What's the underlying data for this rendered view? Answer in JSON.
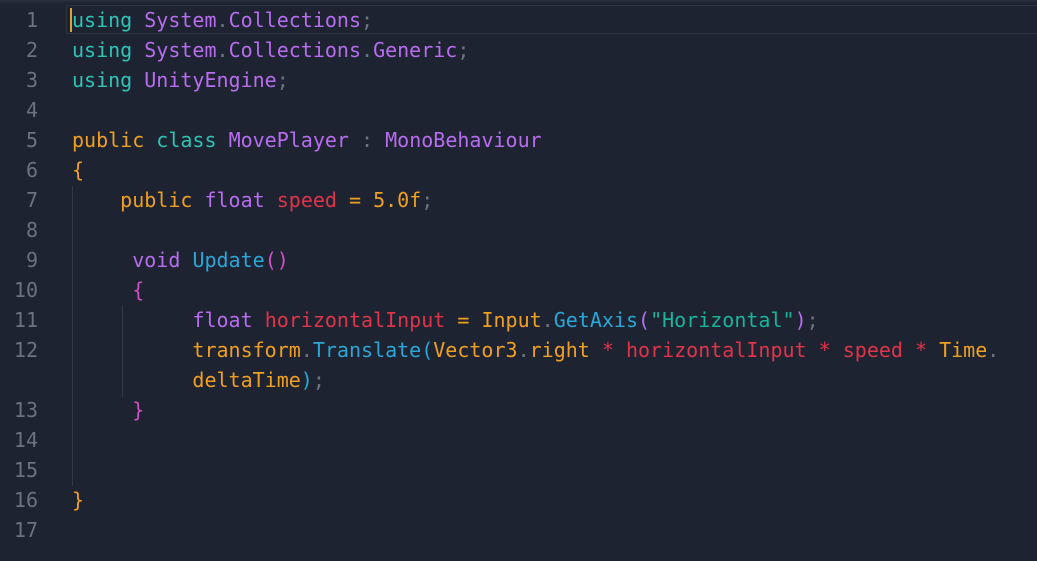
{
  "editor": {
    "line_numbers": [
      "1",
      "2",
      "3",
      "4",
      "5",
      "6",
      "7",
      "8",
      "9",
      "10",
      "11",
      "12",
      "13",
      "14",
      "15",
      "16",
      "17"
    ],
    "lines": [
      {
        "n": "1",
        "tokens": [
          [
            "using",
            "t-kw-teal"
          ],
          [
            " ",
            ""
          ],
          [
            "System",
            "t-class"
          ],
          [
            ".",
            "t-punct"
          ],
          [
            "Collections",
            "t-class"
          ],
          [
            ";",
            "t-punct"
          ]
        ]
      },
      {
        "n": "2",
        "tokens": [
          [
            "using",
            "t-kw-teal"
          ],
          [
            " ",
            ""
          ],
          [
            "System",
            "t-class"
          ],
          [
            ".",
            "t-punct"
          ],
          [
            "Collections",
            "t-class"
          ],
          [
            ".",
            "t-punct"
          ],
          [
            "Generic",
            "t-class"
          ],
          [
            ";",
            "t-punct"
          ]
        ]
      },
      {
        "n": "3",
        "tokens": [
          [
            "using",
            "t-kw-teal"
          ],
          [
            " ",
            ""
          ],
          [
            "UnityEngine",
            "t-class"
          ],
          [
            ";",
            "t-punct"
          ]
        ]
      },
      {
        "n": "4",
        "tokens": []
      },
      {
        "n": "5",
        "tokens": [
          [
            "public",
            "t-kw-orange"
          ],
          [
            " ",
            ""
          ],
          [
            "class",
            "t-kw-teal"
          ],
          [
            " ",
            ""
          ],
          [
            "MovePlayer",
            "t-class"
          ],
          [
            " ",
            ""
          ],
          [
            ":",
            "t-punct"
          ],
          [
            " ",
            ""
          ],
          [
            "MonoBehaviour",
            "t-class"
          ]
        ]
      },
      {
        "n": "6",
        "tokens": [
          [
            "{",
            "t-brace"
          ]
        ]
      },
      {
        "n": "7",
        "tokens": [
          [
            "    ",
            ""
          ],
          [
            "public",
            "t-kw-orange"
          ],
          [
            " ",
            ""
          ],
          [
            "float",
            "t-kw-purple"
          ],
          [
            " ",
            ""
          ],
          [
            "speed",
            "t-var"
          ],
          [
            " ",
            ""
          ],
          [
            "=",
            "t-op"
          ],
          [
            " ",
            ""
          ],
          [
            "5.0f",
            "t-num"
          ],
          [
            ";",
            "t-punct"
          ]
        ]
      },
      {
        "n": "8",
        "tokens": []
      },
      {
        "n": "9",
        "tokens": [
          [
            "     ",
            ""
          ],
          [
            "void",
            "t-kw-purple"
          ],
          [
            " ",
            ""
          ],
          [
            "Update",
            "t-method"
          ],
          [
            "()",
            "t-brace2"
          ]
        ]
      },
      {
        "n": "10",
        "tokens": [
          [
            "     ",
            ""
          ],
          [
            "{",
            "t-brace2"
          ]
        ]
      },
      {
        "n": "11",
        "tokens": [
          [
            "          ",
            ""
          ],
          [
            "float",
            "t-kw-purple"
          ],
          [
            " ",
            ""
          ],
          [
            "horizontalInput",
            "t-var"
          ],
          [
            " ",
            ""
          ],
          [
            "=",
            "t-op"
          ],
          [
            " ",
            ""
          ],
          [
            "Input",
            "t-ident"
          ],
          [
            ".",
            "t-punct"
          ],
          [
            "GetAxis",
            "t-method"
          ],
          [
            "(",
            "t-paren"
          ],
          [
            "\"Horizontal\"",
            "t-str"
          ],
          [
            ")",
            "t-paren"
          ],
          [
            ";",
            "t-punct"
          ]
        ]
      },
      {
        "n": "12",
        "tokens": [
          [
            "          ",
            ""
          ],
          [
            "transform",
            "t-ident"
          ],
          [
            ".",
            "t-punct"
          ],
          [
            "Translate",
            "t-method"
          ],
          [
            "(",
            "t-paren2"
          ],
          [
            "Vector3",
            "t-ident"
          ],
          [
            ".",
            "t-punct"
          ],
          [
            "right",
            "t-ident"
          ],
          [
            " ",
            ""
          ],
          [
            "*",
            "t-var"
          ],
          [
            " ",
            ""
          ],
          [
            "horizontalInput",
            "t-var"
          ],
          [
            " ",
            ""
          ],
          [
            "*",
            "t-var"
          ],
          [
            " ",
            ""
          ],
          [
            "speed",
            "t-var"
          ],
          [
            " ",
            ""
          ],
          [
            "*",
            "t-var"
          ],
          [
            " ",
            ""
          ],
          [
            "Time",
            "t-ident"
          ],
          [
            ".",
            "t-punct"
          ]
        ]
      },
      {
        "n": "",
        "tokens": [
          [
            "          ",
            ""
          ],
          [
            "deltaTime",
            "t-ident"
          ],
          [
            ")",
            "t-paren2"
          ],
          [
            ";",
            "t-punct"
          ]
        ]
      },
      {
        "n": "13",
        "tokens": [
          [
            "     ",
            ""
          ],
          [
            "}",
            "t-brace2"
          ]
        ]
      },
      {
        "n": "14",
        "tokens": []
      },
      {
        "n": "15",
        "tokens": []
      },
      {
        "n": "16",
        "tokens": [
          [
            "}",
            "t-brace"
          ]
        ]
      },
      {
        "n": "17",
        "tokens": []
      }
    ]
  }
}
